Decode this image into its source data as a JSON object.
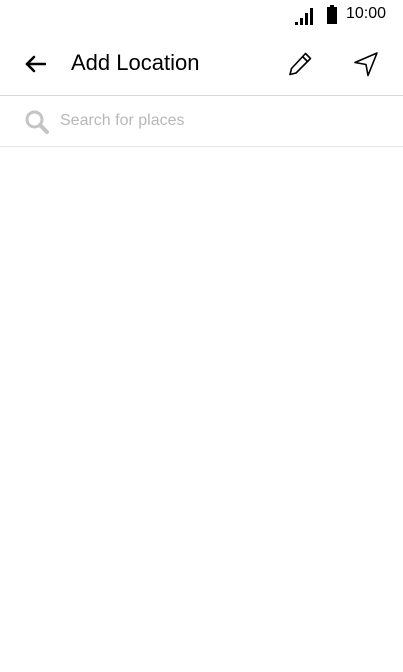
{
  "status_bar": {
    "time": "10:00",
    "signal_icon": "signal-icon",
    "battery_icon": "battery-icon"
  },
  "toolbar": {
    "title": "Add Location",
    "back_icon": "back-arrow-icon",
    "edit_icon": "pencil-icon",
    "location_icon": "navigation-arrow-icon"
  },
  "search": {
    "placeholder": "Search for places",
    "value": "",
    "icon": "search-icon"
  },
  "colors": {
    "background": "#ffffff",
    "text": "#000000",
    "placeholder": "#b8b8b8",
    "divider": "#d9d9d9",
    "search_icon": "#c4c4c4"
  }
}
